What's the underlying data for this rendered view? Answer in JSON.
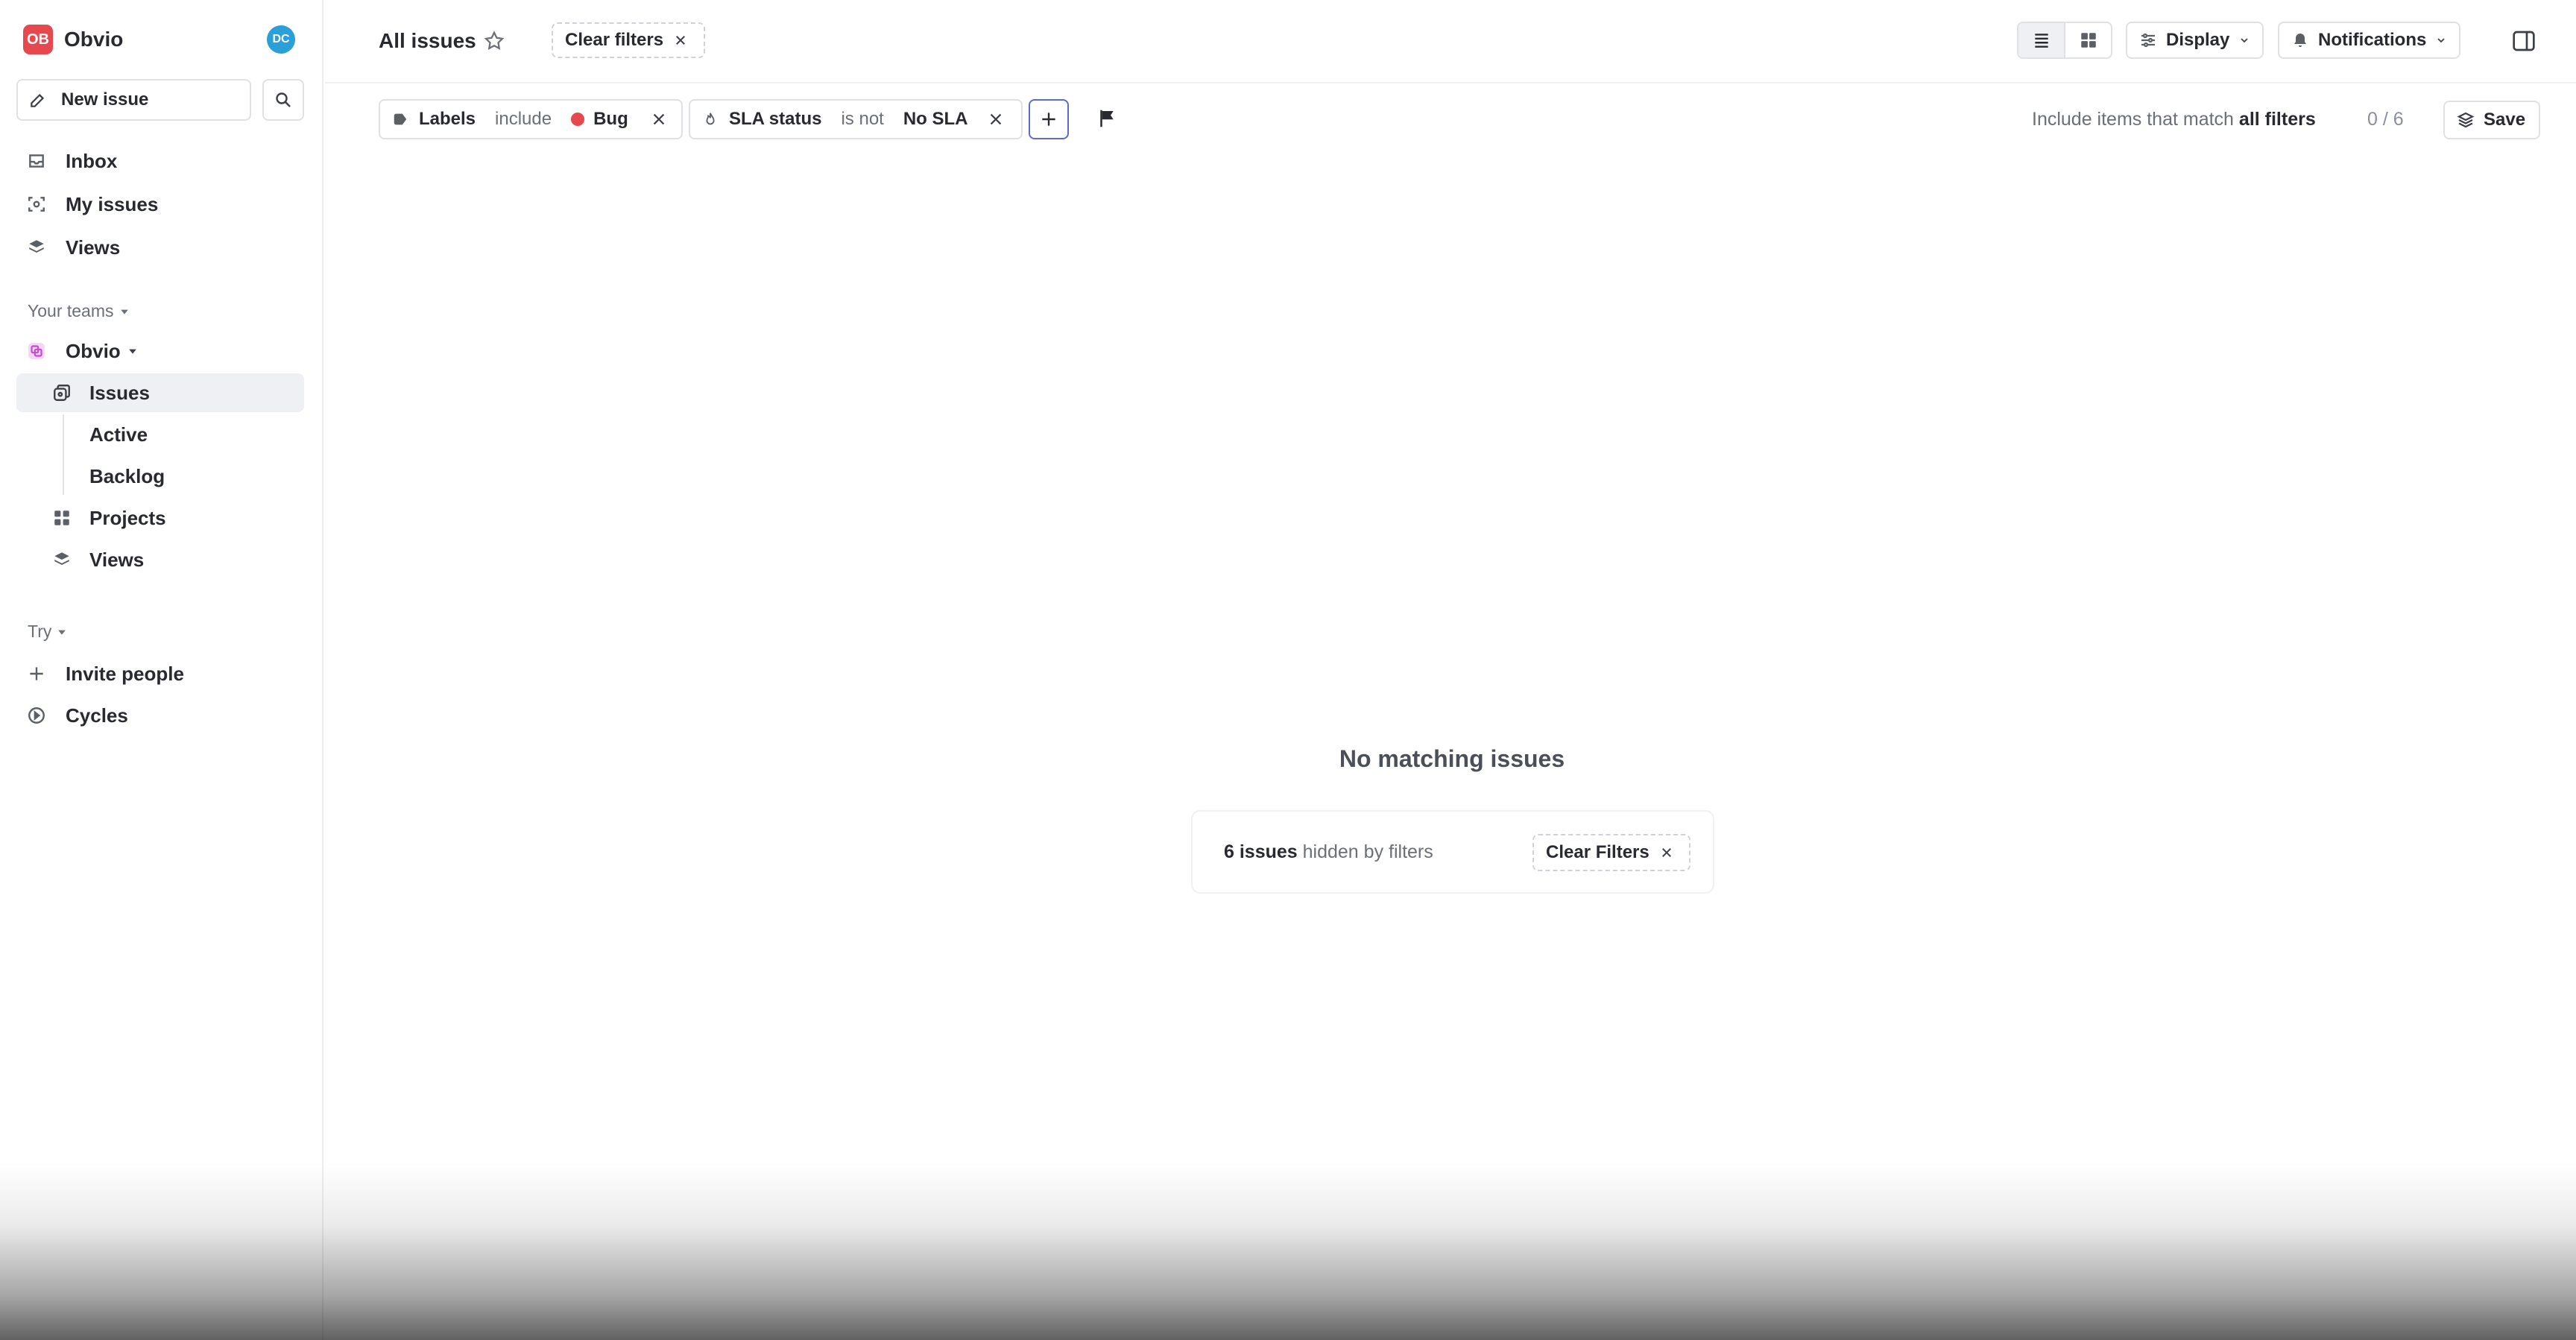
{
  "workspace": {
    "badge": "OB",
    "name": "Obvio",
    "avatar": "DC",
    "badge_color": "#e5484d",
    "avatar_color": "#2a9fd8"
  },
  "sidebar": {
    "new_issue": "New issue",
    "top_items": [
      {
        "label": "Inbox",
        "icon": "inbox-icon"
      },
      {
        "label": "My issues",
        "icon": "my-issues-icon"
      },
      {
        "label": "Views",
        "icon": "views-icon"
      }
    ],
    "your_teams": "Your teams",
    "team": {
      "label": "Obvio",
      "icon": "team-icon"
    },
    "team_items": [
      {
        "label": "Issues",
        "icon": "issues-icon",
        "active": true
      },
      {
        "label": "Active"
      },
      {
        "label": "Backlog"
      },
      {
        "label": "Projects",
        "icon": "projects-icon"
      },
      {
        "label": "Views",
        "icon": "views-icon"
      }
    ],
    "try": "Try",
    "try_items": [
      {
        "label": "Invite people",
        "icon": "plus-icon"
      },
      {
        "label": "Cycles",
        "icon": "cycles-icon"
      }
    ]
  },
  "header": {
    "title": "All issues",
    "clear_filters": "Clear filters",
    "display": "Display",
    "notifications": "Notifications"
  },
  "filters": {
    "labels": {
      "field": "Labels",
      "op": "include",
      "value": "Bug",
      "value_color": "#e5484d"
    },
    "sla": {
      "field": "SLA status",
      "op": "is not",
      "value": "No SLA"
    },
    "match_prefix": "Include items that match",
    "match_mode": "all filters",
    "count": "0 / 6",
    "save": "Save"
  },
  "empty": {
    "title": "No matching issues",
    "hidden_count": "6 issues",
    "hidden_suffix": "hidden by filters",
    "clear": "Clear Filters"
  },
  "accent": "#5e6ad2"
}
